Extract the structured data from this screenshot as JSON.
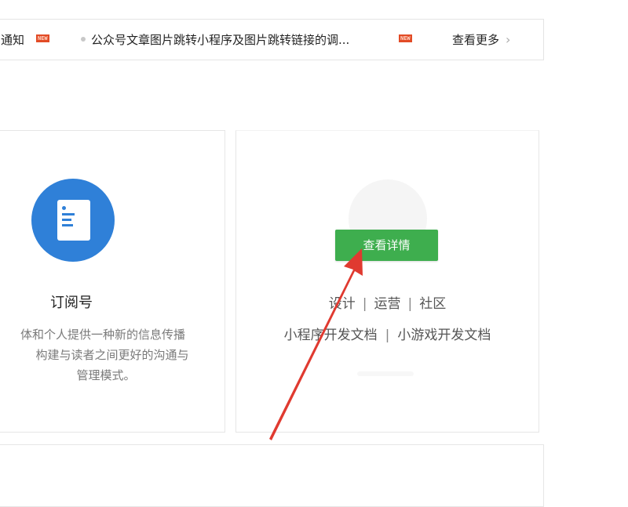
{
  "notice_bar": {
    "items": [
      {
        "text": "通知",
        "badge": "NEW"
      },
      {
        "text": "公众号文章图片跳转小程序及图片跳转链接的调...",
        "badge": "NEW"
      }
    ],
    "more_label": "查看更多",
    "more_icon": "chevron-right-icon"
  },
  "subscription_card": {
    "icon": "document-icon",
    "icon_color": "#2f80d8",
    "title": "订阅号",
    "description_lines": [
      "体和个人提供一种新的信息传播",
      "构建与读者之间更好的沟通与",
      "管理模式。"
    ]
  },
  "mini_program_card": {
    "detail_button_label": "查看详情",
    "button_color": "#3eae4e",
    "links": [
      "设计",
      "运营",
      "社区"
    ],
    "docs": [
      "小程序开发文档",
      "小游戏开发文档"
    ],
    "separator": "|"
  },
  "annotation": {
    "type": "red-arrow",
    "color": "#e03a30"
  }
}
